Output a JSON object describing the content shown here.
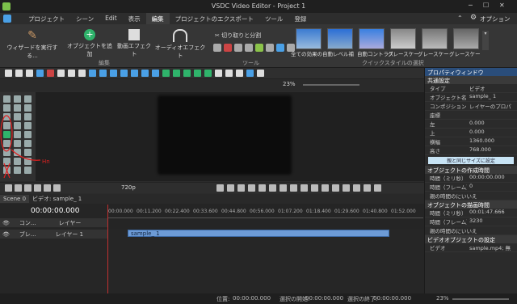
{
  "window": {
    "title": "VSDC Video Editor - Project 1",
    "options_label": "オプション"
  },
  "menu": [
    "プロジェクト",
    "シーン",
    "Edit",
    "表示",
    "編集",
    "プロジェクトのエクスポート",
    "ツール",
    "登録"
  ],
  "menu_active_index": 4,
  "ribbon": {
    "wizard": "ウィザードを実行する...",
    "add_object": "オブジェクトを追加",
    "video_effects": "動画エフェクト",
    "audio_effects": "オーディオエフェクト",
    "group_edit": "編集",
    "cut_split": "切り取りと分割",
    "group_tools": "ツール",
    "group_quickstyles": "クイックスタイルの選択",
    "quickstyles": [
      "全ての効果の自動レベル補",
      "自動コントラス",
      "グレースケー",
      "グレースケー",
      "グレースケー"
    ]
  },
  "toolbar": {
    "zoom": "23%"
  },
  "playback": {
    "resolution": "720p"
  },
  "timeline": {
    "scene_tab": "Scene 0",
    "video_tab": "ビデオ: sample_ 1",
    "timecode": "00:00:00.000",
    "composition_label": "コン...",
    "layer_label": "レイヤー",
    "track_name": "ブレ...",
    "track_layer": "レイヤー 1",
    "clip_name": "sample_ 1",
    "ruler": [
      "00:00.000",
      "00:11.200",
      "00:22.400",
      "00:33.600",
      "00:44.800",
      "00:56.000",
      "01:07.200",
      "01:18.400",
      "01:29.600",
      "01:40.800",
      "01:52.000"
    ]
  },
  "properties": {
    "title": "プロパティウィンドウ",
    "common": "共通設定",
    "type_key": "タイプ",
    "type_val": "ビデオ",
    "objname_key": "オブジェクト名",
    "objname_val": "sample_ 1",
    "comp_key": "コンポジション",
    "comp_val": "レイヤーのプロパ",
    "coords": "座標",
    "left_key": "左",
    "left_val": "0.000",
    "top_key": "上",
    "top_val": "0.000",
    "width_key": "横幅",
    "width_val": "1360.000",
    "height_key": "高さ",
    "height_val": "768.000",
    "same_size_btn": "親と同じサイズに設定",
    "creation_time": "オブジェクトの作成時間",
    "ct_ms_key": "時間（ミリ秒）",
    "ct_ms_val": "00:00:00.000",
    "ct_fr_key": "時間（フレーム）",
    "ct_fr_val": "0",
    "ct_parent": "親の時間のにいいえ",
    "draw_time": "オブジェクトの描画時間",
    "dt_ms_key": "時間（ミリ秒）",
    "dt_ms_val": "00:01:47.666",
    "dt_fr_key": "時間（フレーム）",
    "dt_fr_val": "3230",
    "dt_parent": "親の時間のにいいえ",
    "video_settings": "ビデオオブジェクトの設定",
    "video_key": "ビデオ",
    "video_val": "sample.mp4; 無"
  },
  "status": {
    "position_label": "位置:",
    "position": "00:00:00.000",
    "sel_start_label": "選択の開始:",
    "sel_start": "00:00:00.000",
    "sel_end_label": "選択の終了:",
    "sel_end": "00:00:00.000",
    "zoom": "23%"
  },
  "annotation": {
    "text": "Hn"
  },
  "colors": {
    "accent": "#3b82c4",
    "clip": "#6d9bd6",
    "playhead": "#c03030",
    "annotation": "#e02020"
  }
}
